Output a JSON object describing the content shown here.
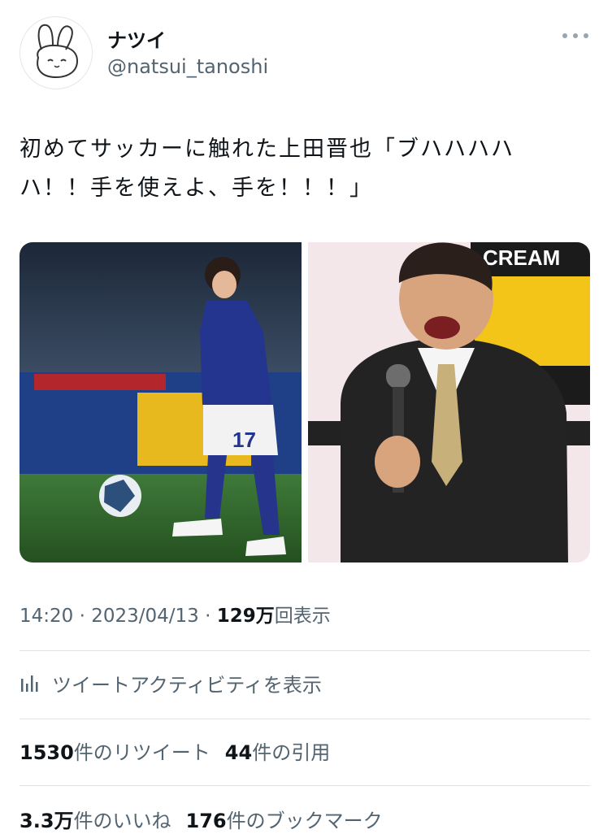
{
  "author": {
    "display_name": "ナツイ",
    "handle": "@natsui_tanoshi",
    "avatar_icon": "bunny-avatar-icon"
  },
  "more_icon": "more-dots-icon",
  "tweet": {
    "text": "初めてサッカーに触れた上田晋也「ブハハハハハ！！手を使えよ、手を！！！」"
  },
  "media": {
    "left_photo": {
      "jersey_number": "17"
    },
    "right_photo": {
      "banner_text": "CREAM"
    }
  },
  "meta": {
    "time": "14:20",
    "separator": " · ",
    "date": "2023/04/13",
    "views_value": "129",
    "views_unit": "万",
    "views_label": "回表示"
  },
  "activity": {
    "icon": "analytics-bars-icon",
    "label": "ツイートアクティビティを表示"
  },
  "stats": {
    "retweets_value": "1530",
    "retweets_label": "件のリツイート",
    "quotes_value": "44",
    "quotes_label": "件の引用",
    "likes_value": "3.3",
    "likes_unit": "万",
    "likes_label": "件のいいね",
    "bookmarks_value": "176",
    "bookmarks_label": "件のブックマーク"
  },
  "colors": {
    "text_primary": "#0f1419",
    "text_secondary": "#536471",
    "divider": "#dfe3e6"
  }
}
